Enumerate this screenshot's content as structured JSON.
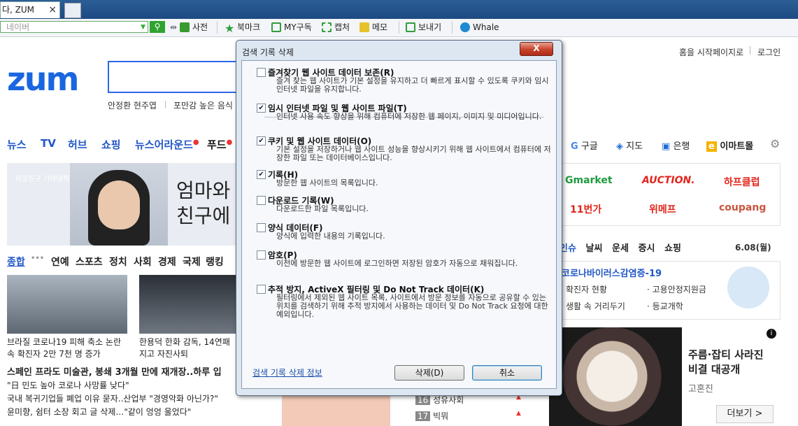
{
  "browser": {
    "tab_title": "다, ZUM",
    "tab_close": "×",
    "search_placeholder": "네이버",
    "toolbar": [
      {
        "label": "사전",
        "icon": "dictionary-icon",
        "color": "#3a9b2f"
      },
      {
        "label": "북마크",
        "icon": "star-icon",
        "color": "#2f9e3a"
      },
      {
        "label": "MY구독",
        "icon": "subscription-icon",
        "color": "#2f9e3a"
      },
      {
        "label": "캡처",
        "icon": "capture-icon",
        "color": "#2f9e3a"
      },
      {
        "label": "메모",
        "icon": "memo-icon",
        "color": "#e6c22a"
      },
      {
        "label": "보내기",
        "icon": "send-icon",
        "color": "#2f9e3a"
      },
      {
        "label": "Whale",
        "icon": "whale-icon",
        "color": "#1f8ad1"
      }
    ]
  },
  "page": {
    "logo": "zum",
    "top_links": {
      "set_home": "홈을 시작페이지로",
      "login": "로그인"
    },
    "search_hints": [
      "안정환 현주엽",
      "포만감 높은 음식"
    ],
    "nav": [
      "뉴스",
      "TV",
      "허브",
      "쇼핑",
      "뉴스어라운드",
      "푸드"
    ],
    "right_links": [
      {
        "label": "구글",
        "icon": "google-icon"
      },
      {
        "label": "지도",
        "icon": "map-icon"
      },
      {
        "label": "은행",
        "icon": "bank-icon"
      },
      {
        "label": "이마트몰",
        "icon": "emart-icon"
      }
    ],
    "banner": {
      "org": "희망친구 기아대책",
      "headline_1": "엄마와",
      "headline_2": "친구에"
    },
    "sub_nav": [
      "종합",
      "연예",
      "스포츠",
      "정치",
      "사회",
      "경제",
      "국제",
      "랭킹"
    ],
    "photo_captions": [
      {
        "line1": "브라질 코로나19 피해 축소 논란",
        "line2": "속 확진자 2만 7천 명 증가"
      },
      {
        "line1": "한용덕 한화 감독, 14연패",
        "line2": "지고 자진사퇴"
      }
    ],
    "news": [
      "스페인 프라도 미술관, 봉쇄 3개월 만에 재개장..하루 입",
      "\"日 민도 높아 코로나 사망률 낮다\"",
      "국내 복귀기업들 폐업 이유 묻자..산업부 \"경영악화 아닌가?\"",
      "윤미향, 쉼터 소장 회고 글 삭제…\"같이 엉엉 울었다\""
    ],
    "shops": [
      {
        "label": "Gmarket",
        "color": "#1e9a3d"
      },
      {
        "label": "AUCTION.",
        "color": "#e1251b"
      },
      {
        "label": "하프클럽",
        "color": "#e1251b"
      },
      {
        "label": "11번가",
        "color": "#e1251b"
      },
      {
        "label": "위메프",
        "color": "#e1251b"
      },
      {
        "label": "coupang",
        "color": "#c8553d"
      }
    ],
    "topics": [
      "인슈",
      "날씨",
      "운세",
      "증시",
      "쇼핑"
    ],
    "date": "6.08(월)",
    "corona": {
      "title": "코로나바이러스감염증-19",
      "items": [
        "확진자 현황",
        "고용안정지원금",
        "생활 속 거리두기",
        "등교개학"
      ]
    },
    "ranking": [
      {
        "num": "16",
        "label": "성유사회"
      },
      {
        "num": "17",
        "label": "빅뭐"
      }
    ],
    "ad": {
      "line1": "주름·잡티 사라진",
      "line2": "비결 대공개",
      "source": "고혼진",
      "more": "더보기 >"
    }
  },
  "dialog": {
    "title": "검색 기록 삭제",
    "close": "X",
    "options": [
      {
        "label": "즐겨찾기 웹 사이트 데이터 보존(R)",
        "checked": false,
        "desc": "즐겨 찾는 웹 사이트가 기본 설정을 유지하고 더 빠르게 표시할 수 있도록 쿠키와 임시 인터넷 파일을 유지합니다."
      },
      {
        "label": "임시 인터넷 파일 및 웹 사이트 파일(T)",
        "checked": true,
        "desc": "인터넷 사용 속도 향상을 위해 컴퓨터에 저장한 웹 페이지, 이미지 및 미디어입니다."
      },
      {
        "label": "쿠키 및 웹 사이트 데이터(O)",
        "checked": true,
        "desc": "기본 설정을 저장하거나 웹 사이트 성능을 향상시키기 위해 웹 사이트에서 컴퓨터에 저장한 파일 또는 데이터베이스입니다."
      },
      {
        "label": "기록(H)",
        "checked": true,
        "desc": "방문한 웹 사이트의 목록입니다."
      },
      {
        "label": "다운로드 기록(W)",
        "checked": false,
        "desc": "다운로드한 파일 목록입니다."
      },
      {
        "label": "양식 데이터(F)",
        "checked": false,
        "desc": "양식에 입력한 내용의 기록입니다."
      },
      {
        "label": "암호(P)",
        "checked": false,
        "desc": "이전에 방문한 웹 사이트에 로그인하면 저장된 암호가 자동으로 채워집니다."
      },
      {
        "label": "추적 방지, ActiveX 필터링 및 Do Not Track 데이터(K)",
        "checked": false,
        "desc": "필터링에서 제외된 웹 사이트 목록, 사이트에서 방문 정보를 자동으로 공유할 수 있는 위치를 검색하기 위해 추적 방지에서 사용하는 데이터 및 Do Not Track 요청에 대한 예외입니다."
      }
    ],
    "info_link": "검색 기록 삭제 정보",
    "delete_button": "삭제(D)",
    "cancel_button": "취소"
  }
}
